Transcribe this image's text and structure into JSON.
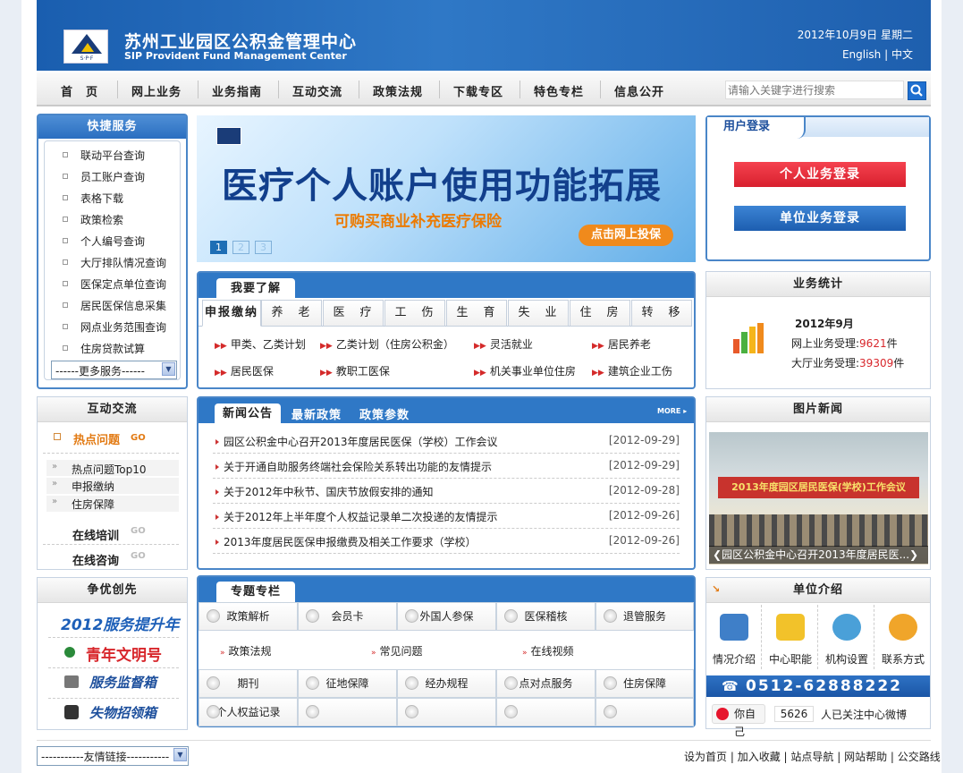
{
  "header": {
    "title_cn": "苏州工业园区公积金管理中心",
    "title_en": "SIP Provident Fund Management Center",
    "logo_text": "S·P·F",
    "date": "2012年10月9日 星期二",
    "lang_en": "English",
    "lang_sep": "|",
    "lang_cn": "中文"
  },
  "nav": {
    "items": [
      "首　页",
      "网上业务",
      "业务指南",
      "互动交流",
      "政策法规",
      "下载专区",
      "特色专栏",
      "信息公开"
    ],
    "search_placeholder": "请输入关键字进行搜索"
  },
  "quick": {
    "title": "快捷服务",
    "items": [
      "联动平台查询",
      "员工账户查询",
      "表格下载",
      "政策检索",
      "个人编号查询",
      "大厅排队情况查询",
      "医保定点单位查询",
      "居民医保信息采集",
      "网点业务范围查询",
      "住房贷款试算"
    ],
    "more_select": "------更多服务------"
  },
  "interact": {
    "title": "互动交流",
    "hot": "热点问题",
    "go": "GO",
    "sub_items": [
      "热点问题Top10",
      "申报缴纳",
      "住房保障"
    ],
    "training": "在线培训",
    "consult": "在线咨询"
  },
  "excellence": {
    "title": "争优创先",
    "items": [
      "2012服务提升年",
      "青年文明号",
      "服务监督箱",
      "失物招领箱"
    ]
  },
  "banner": {
    "title": "医疗个人账户使用功能拓展",
    "subtitle": "可购买商业补充医疗保险",
    "button": "点击网上投保",
    "pages": [
      "1",
      "2",
      "3"
    ]
  },
  "know": {
    "title": "我要了解",
    "tabs": [
      "申报缴纳",
      "养　老",
      "医　疗",
      "工　伤",
      "生　育",
      "失　业",
      "住　房",
      "转　移"
    ],
    "links_row1": [
      "甲类、乙类计划",
      "乙类计划（住房公积金）",
      "灵活就业",
      "居民养老"
    ],
    "links_row2": [
      "居民医保",
      "教职工医保",
      "机关事业单位住房",
      "建筑企业工伤"
    ]
  },
  "news": {
    "tabs": [
      "新闻公告",
      "最新政策",
      "政策参数"
    ],
    "more": "MORE",
    "items": [
      {
        "title": "园区公积金中心召开2013年度居民医保（学校）工作会议",
        "date": "[2012-09-29]"
      },
      {
        "title": "关于开通自助服务终端社会保险关系转出功能的友情提示",
        "date": "[2012-09-29]"
      },
      {
        "title": "关于2012年中秋节、国庆节放假安排的通知",
        "date": "[2012-09-28]"
      },
      {
        "title": "关于2012年上半年度个人权益记录单二次投递的友情提示",
        "date": "[2012-09-26]"
      },
      {
        "title": "2013年度居民医保申报缴费及相关工作要求（学校）",
        "date": "[2012-09-26]"
      }
    ]
  },
  "topics": {
    "title": "专题专栏",
    "row1": [
      "政策解析",
      "会员卡",
      "外国人参保",
      "医保稽核",
      "退管服务"
    ],
    "links": [
      "政策法规",
      "常见问题",
      "在线视频"
    ],
    "row2": [
      "期刊",
      "征地保障",
      "经办规程",
      "点对点服务",
      "住房保障"
    ],
    "row3": [
      "个人权益记录",
      "",
      "",
      "",
      ""
    ]
  },
  "login": {
    "title": "用户登录",
    "personal": "个人业务登录",
    "unit": "单位业务登录"
  },
  "stats": {
    "title": "业务统计",
    "month": "2012年9月",
    "online_label": "网上业务受理:",
    "online_value": "9621",
    "hall_label": "大厅业务受理:",
    "hall_value": "39309",
    "unit": "件"
  },
  "photo": {
    "title": "图片新闻",
    "banner_text": "2013年度园区居民医保(学校)工作会议",
    "caption": "园区公积金中心召开2013年度居民医..."
  },
  "unit_intro": {
    "title": "单位介绍",
    "items": [
      "情况介绍",
      "中心职能",
      "机构设置",
      "联系方式"
    ],
    "phone": "0512-62888222",
    "weibo_label": "你自己",
    "weibo_count": "5626",
    "weibo_text": "人已关注中心微博"
  },
  "footer": {
    "links_select": "-----------友情链接-----------",
    "links": [
      "设为首页",
      "加入收藏",
      "站点导航",
      "网站帮助",
      "公交路线"
    ]
  },
  "colors": {
    "brand_blue": "#2a6ec0",
    "accent_orange": "#ec7a00",
    "login_red": "#e42a3a",
    "login_blue": "#2a6ec0"
  }
}
